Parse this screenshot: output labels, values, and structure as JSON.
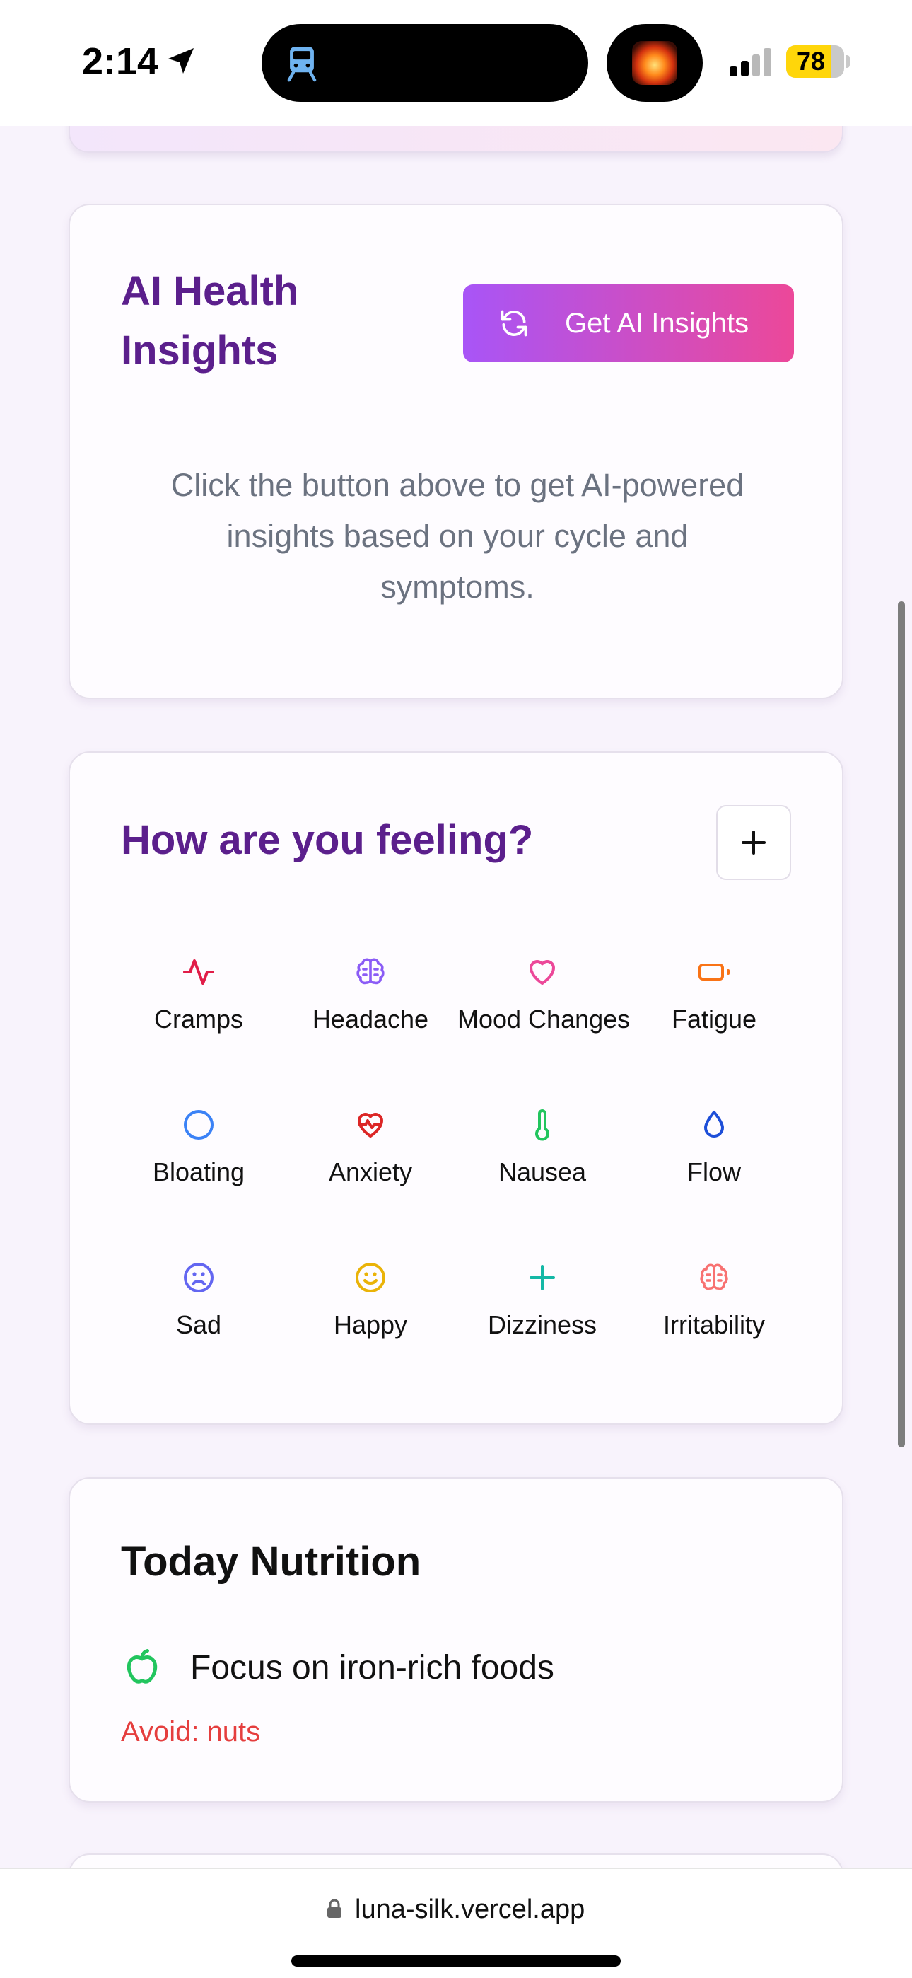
{
  "status_bar": {
    "time": "2:14",
    "battery": "78",
    "battery_level_percent": 78
  },
  "ai_card": {
    "title": "AI Health Insights",
    "button_label": "Get AI Insights",
    "description": "Click the button above to get AI-powered insights based on your cycle and symptoms."
  },
  "feel_card": {
    "title": "How are you feeling?",
    "symptoms": [
      {
        "label": "Cramps",
        "icon": "activity-icon",
        "color": "#e11d48"
      },
      {
        "label": "Headache",
        "icon": "brain-icon",
        "color": "#8b5cf6"
      },
      {
        "label": "Mood Changes",
        "icon": "heart-icon",
        "color": "#ec4899"
      },
      {
        "label": "Fatigue",
        "icon": "battery-low-icon",
        "color": "#f97316"
      },
      {
        "label": "Bloating",
        "icon": "circle-icon",
        "color": "#3b82f6"
      },
      {
        "label": "Anxiety",
        "icon": "heart-pulse-icon",
        "color": "#dc2626"
      },
      {
        "label": "Nausea",
        "icon": "thermometer-icon",
        "color": "#22c55e"
      },
      {
        "label": "Flow",
        "icon": "droplet-icon",
        "color": "#1d4ed8"
      },
      {
        "label": "Sad",
        "icon": "frown-icon",
        "color": "#6366f1"
      },
      {
        "label": "Happy",
        "icon": "smile-icon",
        "color": "#eab308"
      },
      {
        "label": "Dizziness",
        "icon": "plus-icon",
        "color": "#14b8a6"
      },
      {
        "label": "Irritability",
        "icon": "brain-icon",
        "color": "#f87171"
      }
    ]
  },
  "nutrition_card": {
    "title": "Today Nutrition",
    "focus": "Focus on iron-rich foods",
    "avoid": "Avoid: nuts"
  },
  "browser": {
    "url": "luna-silk.vercel.app"
  },
  "colors": {
    "accent_purple": "#5b1f8c",
    "gradient_start": "#a855f7",
    "gradient_end": "#ec4899",
    "avoid_red": "#e53e3e",
    "page_bg": "#f8f3fc"
  }
}
